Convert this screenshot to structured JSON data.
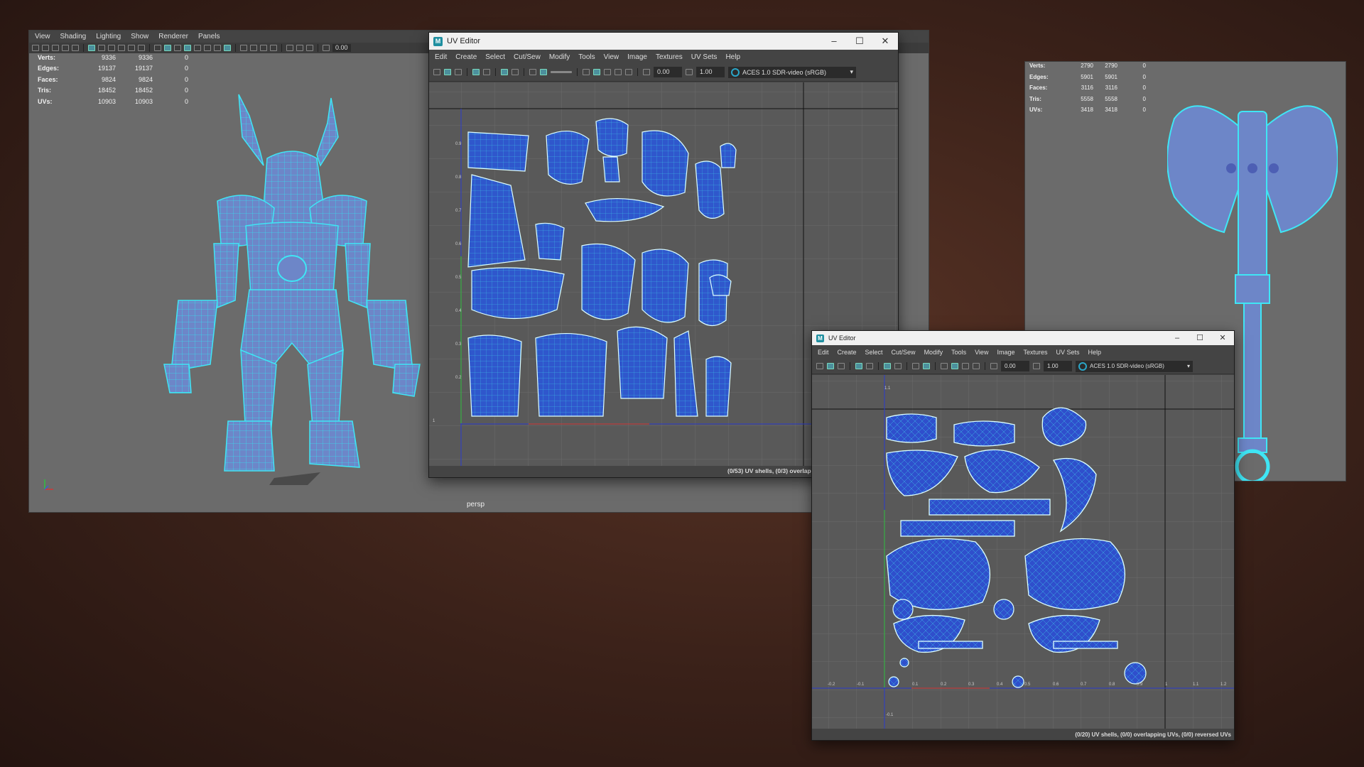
{
  "viewport": {
    "menu": [
      "View",
      "Shading",
      "Lighting",
      "Show",
      "Renderer",
      "Panels"
    ],
    "field_value": "0.00",
    "stats": [
      {
        "label": "Verts:",
        "a": "9336",
        "b": "9336",
        "c": "0"
      },
      {
        "label": "Edges:",
        "a": "19137",
        "b": "19137",
        "c": "0"
      },
      {
        "label": "Faces:",
        "a": "9824",
        "b": "9824",
        "c": "0"
      },
      {
        "label": "Tris:",
        "a": "18452",
        "b": "18452",
        "c": "0"
      },
      {
        "label": "UVs:",
        "a": "10903",
        "b": "10903",
        "c": "0"
      }
    ],
    "camera": "persp",
    "model_icon": "minotaur-wireframe-model"
  },
  "axe_panel": {
    "stats": [
      {
        "label": "Verts:",
        "a": "2790",
        "b": "2790",
        "c": "0"
      },
      {
        "label": "Edges:",
        "a": "5901",
        "b": "5901",
        "c": "0"
      },
      {
        "label": "Faces:",
        "a": "3116",
        "b": "3116",
        "c": "0"
      },
      {
        "label": "Tris:",
        "a": "5558",
        "b": "5558",
        "c": "0"
      },
      {
        "label": "UVs:",
        "a": "3418",
        "b": "3418",
        "c": "0"
      }
    ],
    "model_icon": "double-axe-wireframe-model"
  },
  "uv1": {
    "title": "UV Editor",
    "menu": [
      "Edit",
      "Create",
      "Select",
      "Cut/Sew",
      "Modify",
      "Tools",
      "View",
      "Image",
      "Textures",
      "UV Sets",
      "Help"
    ],
    "field1": "0.00",
    "field2": "1.00",
    "colorspace": "ACES 1.0 SDR-video (sRGB)",
    "status": "(0/53) UV shells, (0/3) overlapp",
    "ticks_v": [
      "0.9",
      "0.8",
      "0.7",
      "0.6",
      "0.5",
      "0.4",
      "0.3",
      "0.2"
    ],
    "tick_origin": "1"
  },
  "uv2": {
    "title": "UV Editor",
    "menu": [
      "Edit",
      "Create",
      "Select",
      "Cut/Sew",
      "Modify",
      "Tools",
      "View",
      "Image",
      "Textures",
      "UV Sets",
      "Help"
    ],
    "field1": "0.00",
    "field2": "1.00",
    "colorspace": "ACES 1.0 SDR-video (sRGB)",
    "status": "(0/20) UV shells, (0/0) overlapping UVs, (0/0) reversed UVs",
    "ticks_top": "1.1",
    "ticks_h": [
      "-0.2",
      "-0.1",
      "0.1",
      "0.2",
      "0.3",
      "0.4",
      "0.5",
      "0.6",
      "0.7",
      "0.8",
      "0.9",
      "1",
      "1.1",
      "1.2"
    ],
    "tick_bottom": "-0.1"
  },
  "colors": {
    "wire": "#35d8ec",
    "shell": "#2f55c8",
    "mesh": "#6f86c9"
  }
}
